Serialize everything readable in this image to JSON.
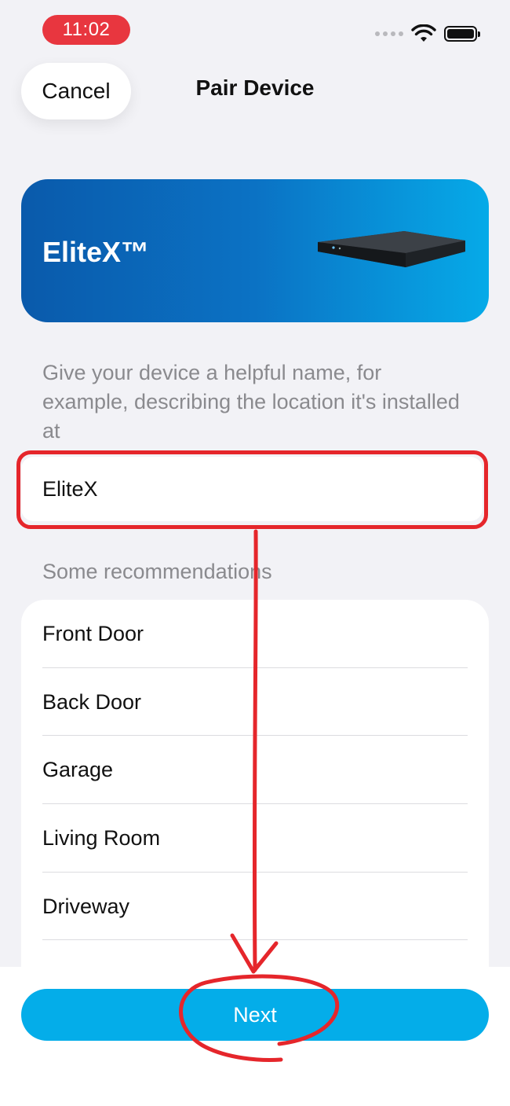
{
  "status_bar": {
    "time": "11:02"
  },
  "header": {
    "cancel_label": "Cancel",
    "title": "Pair Device"
  },
  "banner": {
    "device_name": "EliteX™"
  },
  "form": {
    "description": "Give your device a helpful name, for example, describing the location it's installed at",
    "name_value": "EliteX"
  },
  "recommendations": {
    "label": "Some recommendations",
    "items": [
      "Front Door",
      "Back Door",
      "Garage",
      "Living Room",
      "Driveway",
      ""
    ]
  },
  "footer": {
    "next_label": "Next"
  },
  "colors": {
    "accent": "#04ade9",
    "time_pill": "#e8363f",
    "annotation": "#e5262b",
    "banner_start": "#0a5aab",
    "banner_end": "#06aae8"
  }
}
